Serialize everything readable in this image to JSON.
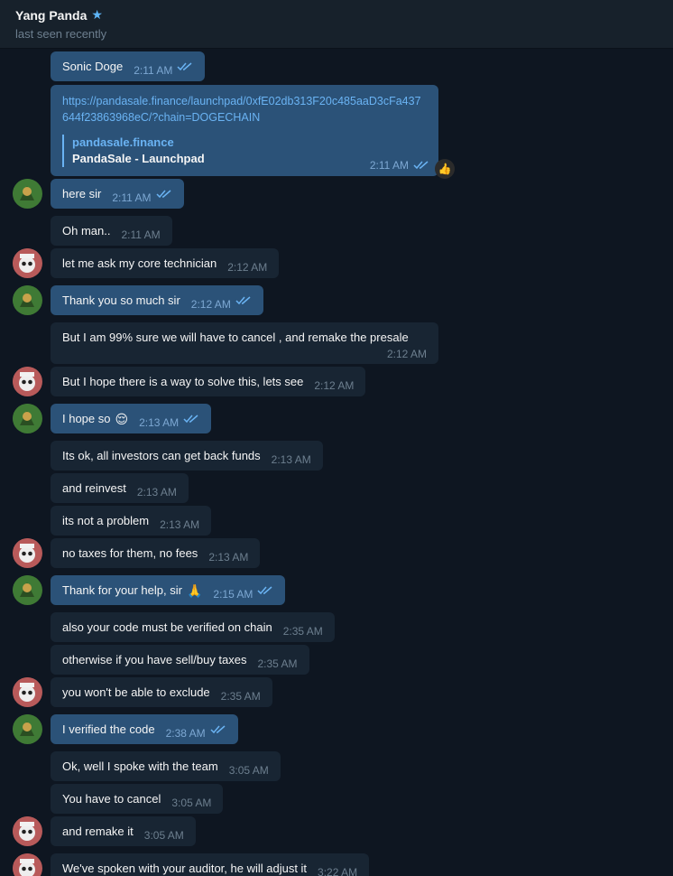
{
  "header": {
    "name": "Yang Panda",
    "status": "last seen recently",
    "verified_icon": "star-icon"
  },
  "messages": [
    {
      "dir": "out",
      "text": "Sonic Doge",
      "time": "2:11 AM",
      "read": true
    },
    {
      "dir": "out",
      "type": "link",
      "url": "https://pandasale.finance/launchpad/0xfE02db313F20c485aaD3cFa437644f23863968eC/?chain=DOGECHAIN",
      "site": "pandasale.finance",
      "title": "PandaSale - Launchpad",
      "time": "2:11 AM",
      "read": true,
      "reaction": "👍"
    },
    {
      "dir": "out",
      "text": "here sir",
      "time": "2:11 AM",
      "read": true
    },
    {
      "dir": "in",
      "text": "Oh man..",
      "time": "2:11 AM"
    },
    {
      "dir": "in",
      "text": "let me ask my core technician",
      "time": "2:12 AM"
    },
    {
      "dir": "out",
      "text": "Thank you so much sir",
      "time": "2:12 AM",
      "read": true
    },
    {
      "dir": "in",
      "text": "But I am 99% sure we will have to cancel , and remake the presale",
      "time": "2:12 AM"
    },
    {
      "dir": "in",
      "text": "But I hope there is a way to solve this, lets see",
      "time": "2:12 AM"
    },
    {
      "dir": "out",
      "text": "I hope so",
      "emoji": "😌",
      "time": "2:13 AM",
      "read": true
    },
    {
      "dir": "in",
      "text": "Its ok, all investors can get back funds",
      "time": "2:13 AM"
    },
    {
      "dir": "in",
      "text": "and reinvest",
      "time": "2:13 AM"
    },
    {
      "dir": "in",
      "text": "its not a problem",
      "time": "2:13 AM"
    },
    {
      "dir": "in",
      "text": "no taxes for them, no fees",
      "time": "2:13 AM"
    },
    {
      "dir": "out",
      "text": "Thank for your help, sir",
      "emoji": "🙏",
      "time": "2:15 AM",
      "read": true
    },
    {
      "dir": "in",
      "text": "also your code must be verified on chain",
      "time": "2:35 AM"
    },
    {
      "dir": "in",
      "text": "otherwise if you have sell/buy taxes",
      "time": "2:35 AM"
    },
    {
      "dir": "in",
      "text": "you won't be able to exclude",
      "time": "2:35 AM"
    },
    {
      "dir": "out",
      "text": "I verified the code",
      "time": "2:38 AM",
      "read": true
    },
    {
      "dir": "in",
      "text": "Ok, well I spoke with the team",
      "time": "3:05 AM"
    },
    {
      "dir": "in",
      "text": "You have to cancel",
      "time": "3:05 AM"
    },
    {
      "dir": "in",
      "text": "and remake it",
      "time": "3:05 AM"
    },
    {
      "dir": "in",
      "text": "We've spoken with your auditor, he will adjust it",
      "time": "3:22 AM"
    }
  ],
  "colors": {
    "background": "#0e1621",
    "header": "#17212b",
    "incoming": "#182533",
    "outgoing": "#2b5278",
    "link": "#6ab3f3"
  }
}
